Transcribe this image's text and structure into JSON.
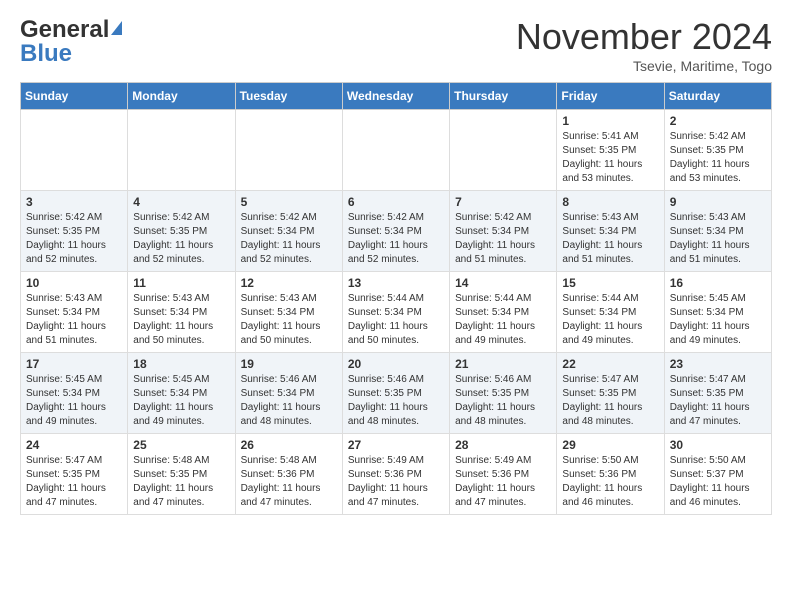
{
  "header": {
    "logo_line1": "General",
    "logo_line2": "Blue",
    "month_title": "November 2024",
    "location": "Tsevie, Maritime, Togo"
  },
  "days_of_week": [
    "Sunday",
    "Monday",
    "Tuesday",
    "Wednesday",
    "Thursday",
    "Friday",
    "Saturday"
  ],
  "weeks": [
    [
      {
        "day": "",
        "info": ""
      },
      {
        "day": "",
        "info": ""
      },
      {
        "day": "",
        "info": ""
      },
      {
        "day": "",
        "info": ""
      },
      {
        "day": "",
        "info": ""
      },
      {
        "day": "1",
        "info": "Sunrise: 5:41 AM\nSunset: 5:35 PM\nDaylight: 11 hours and 53 minutes."
      },
      {
        "day": "2",
        "info": "Sunrise: 5:42 AM\nSunset: 5:35 PM\nDaylight: 11 hours and 53 minutes."
      }
    ],
    [
      {
        "day": "3",
        "info": "Sunrise: 5:42 AM\nSunset: 5:35 PM\nDaylight: 11 hours and 52 minutes."
      },
      {
        "day": "4",
        "info": "Sunrise: 5:42 AM\nSunset: 5:35 PM\nDaylight: 11 hours and 52 minutes."
      },
      {
        "day": "5",
        "info": "Sunrise: 5:42 AM\nSunset: 5:34 PM\nDaylight: 11 hours and 52 minutes."
      },
      {
        "day": "6",
        "info": "Sunrise: 5:42 AM\nSunset: 5:34 PM\nDaylight: 11 hours and 52 minutes."
      },
      {
        "day": "7",
        "info": "Sunrise: 5:42 AM\nSunset: 5:34 PM\nDaylight: 11 hours and 51 minutes."
      },
      {
        "day": "8",
        "info": "Sunrise: 5:43 AM\nSunset: 5:34 PM\nDaylight: 11 hours and 51 minutes."
      },
      {
        "day": "9",
        "info": "Sunrise: 5:43 AM\nSunset: 5:34 PM\nDaylight: 11 hours and 51 minutes."
      }
    ],
    [
      {
        "day": "10",
        "info": "Sunrise: 5:43 AM\nSunset: 5:34 PM\nDaylight: 11 hours and 51 minutes."
      },
      {
        "day": "11",
        "info": "Sunrise: 5:43 AM\nSunset: 5:34 PM\nDaylight: 11 hours and 50 minutes."
      },
      {
        "day": "12",
        "info": "Sunrise: 5:43 AM\nSunset: 5:34 PM\nDaylight: 11 hours and 50 minutes."
      },
      {
        "day": "13",
        "info": "Sunrise: 5:44 AM\nSunset: 5:34 PM\nDaylight: 11 hours and 50 minutes."
      },
      {
        "day": "14",
        "info": "Sunrise: 5:44 AM\nSunset: 5:34 PM\nDaylight: 11 hours and 49 minutes."
      },
      {
        "day": "15",
        "info": "Sunrise: 5:44 AM\nSunset: 5:34 PM\nDaylight: 11 hours and 49 minutes."
      },
      {
        "day": "16",
        "info": "Sunrise: 5:45 AM\nSunset: 5:34 PM\nDaylight: 11 hours and 49 minutes."
      }
    ],
    [
      {
        "day": "17",
        "info": "Sunrise: 5:45 AM\nSunset: 5:34 PM\nDaylight: 11 hours and 49 minutes."
      },
      {
        "day": "18",
        "info": "Sunrise: 5:45 AM\nSunset: 5:34 PM\nDaylight: 11 hours and 49 minutes."
      },
      {
        "day": "19",
        "info": "Sunrise: 5:46 AM\nSunset: 5:34 PM\nDaylight: 11 hours and 48 minutes."
      },
      {
        "day": "20",
        "info": "Sunrise: 5:46 AM\nSunset: 5:35 PM\nDaylight: 11 hours and 48 minutes."
      },
      {
        "day": "21",
        "info": "Sunrise: 5:46 AM\nSunset: 5:35 PM\nDaylight: 11 hours and 48 minutes."
      },
      {
        "day": "22",
        "info": "Sunrise: 5:47 AM\nSunset: 5:35 PM\nDaylight: 11 hours and 48 minutes."
      },
      {
        "day": "23",
        "info": "Sunrise: 5:47 AM\nSunset: 5:35 PM\nDaylight: 11 hours and 47 minutes."
      }
    ],
    [
      {
        "day": "24",
        "info": "Sunrise: 5:47 AM\nSunset: 5:35 PM\nDaylight: 11 hours and 47 minutes."
      },
      {
        "day": "25",
        "info": "Sunrise: 5:48 AM\nSunset: 5:35 PM\nDaylight: 11 hours and 47 minutes."
      },
      {
        "day": "26",
        "info": "Sunrise: 5:48 AM\nSunset: 5:36 PM\nDaylight: 11 hours and 47 minutes."
      },
      {
        "day": "27",
        "info": "Sunrise: 5:49 AM\nSunset: 5:36 PM\nDaylight: 11 hours and 47 minutes."
      },
      {
        "day": "28",
        "info": "Sunrise: 5:49 AM\nSunset: 5:36 PM\nDaylight: 11 hours and 47 minutes."
      },
      {
        "day": "29",
        "info": "Sunrise: 5:50 AM\nSunset: 5:36 PM\nDaylight: 11 hours and 46 minutes."
      },
      {
        "day": "30",
        "info": "Sunrise: 5:50 AM\nSunset: 5:37 PM\nDaylight: 11 hours and 46 minutes."
      }
    ]
  ]
}
